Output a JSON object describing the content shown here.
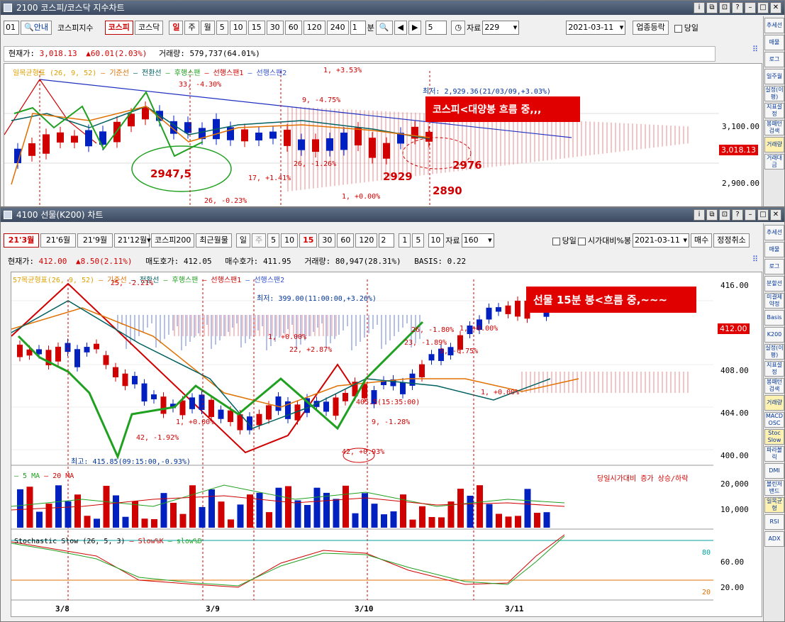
{
  "win1": {
    "title": "2100 코스피/코스닥 지수차트",
    "code": "01",
    "guide": "안내",
    "index_name": "코스피지수",
    "tab_kospi": "코스피",
    "tab_kosdaq": "코스닥",
    "periods": [
      "일",
      "주",
      "월",
      "5",
      "10",
      "15",
      "30",
      "60",
      "120",
      "240"
    ],
    "min_value": "1",
    "min_unit": "분",
    "count": "5",
    "data_label": "자료",
    "data_count": "229",
    "date": "2021-03-11",
    "updown": "업종등락",
    "today": "당일",
    "info": {
      "cur_label": "현재가:",
      "cur": "3,018.13",
      "chg": "▲60.01(2.03%)",
      "vol_label": "거래량:",
      "vol": "579,737(64.01%)"
    },
    "legend": [
      "일목균형표 (26, 9, 52)",
      "기준선",
      "전환선",
      "후행스팬",
      "선행스팬1",
      "선행스팬2"
    ],
    "legend_colors": [
      "#e0a000",
      "#e07000",
      "#006060",
      "#20a020",
      "#d00000",
      "#3050d0"
    ],
    "low_note": "최저: 2,929.36(21/03/09,+3.03%)",
    "annotation": "코스피<대양봉 흐름 중,,,",
    "big_labels": [
      "2947,5",
      "2929",
      "2976",
      "2890"
    ],
    "measure_labels": [
      "33, -4.30%",
      "9, -4.75%",
      "26, -1.26%",
      "17, +1.41%",
      "26, -0.23%",
      "1, +0.00%",
      "1, +3.53%"
    ],
    "axis": [
      "3,100.00",
      "2,900.00"
    ],
    "price_tag": "3,018.13",
    "sidebar": [
      "추세선",
      "매물",
      "로그",
      "일주월",
      "실정(이평)",
      "지표설정",
      "봉패턴검색",
      "거래량",
      "거래대금"
    ]
  },
  "win2": {
    "title": "4100 선물(K200) 차트",
    "contracts": [
      "21'3월",
      "21'6월",
      "21'9월",
      "21'12월"
    ],
    "kospi200": "코스피200",
    "recent_month": "최근월물",
    "periods": [
      "일",
      "주",
      "5",
      "10",
      "15",
      "30",
      "60",
      "120"
    ],
    "min_value": "2",
    "ticks": [
      "1",
      "5"
    ],
    "tick_value": "10",
    "data_label": "자료",
    "data_count": "160",
    "today": "당일",
    "open_vs": "시가대비%봉",
    "date": "2021-03-11",
    "buy": "매수",
    "correct_cancel": "정정취소",
    "info": {
      "cur_label": "현재가:",
      "cur": "412.00",
      "chg": "▲8.50(2.11%)",
      "ask_label": "매도호가:",
      "ask": "412.05",
      "bid_label": "매수호가:",
      "bid": "411.95",
      "vol_label": "거래량:",
      "vol": "80,947(28.31%)",
      "basis_label": "BASIS:",
      "basis": "0.22"
    },
    "legend": [
      "57목균형표(26, 9, 52)",
      "기준선",
      "전환선",
      "후행스팬",
      "선행스팬1",
      "선행스팬2"
    ],
    "legend_colors": [
      "#e0a000",
      "#e07000",
      "#006060",
      "#20a020",
      "#d00000",
      "#3050d0"
    ],
    "low_note": "최저: 399.00(11:00:00,+3.26%)",
    "high_note": "최고: 415.85(09:15:00,-0.93%)",
    "annotation": "선물 15분 봉<흐름 중,~~~",
    "measure_labels": [
      "25, -2.21%",
      "1, +0.00%",
      "22, +2.87%",
      "26, -1.80%",
      "1, +0.00%",
      "23, -1.89%",
      "9, -0.75%",
      "1, +0.00%",
      "1, +0.00%",
      "42, -1.92%",
      "42, +0.93%",
      "9, -1.28%",
      "405.5(15:35:00)"
    ],
    "axis": [
      "416.00",
      "408.00",
      "404.00",
      "400.00"
    ],
    "price_tag": "412.00",
    "vol_legend": [
      "5 MA",
      "20 MA"
    ],
    "vol_note": "당일시가대비 증가 상승/하락",
    "vol_axis": [
      "20,000",
      "10,000"
    ],
    "stoch_title": "Stochastic Slow (26, 5, 3)",
    "stoch_legend": [
      "Slow%K",
      "slow%D"
    ],
    "stoch_levels": [
      "80",
      "20"
    ],
    "stoch_axis": [
      "60.00",
      "20.00"
    ],
    "dates": [
      "3/8",
      "3/9",
      "3/10",
      "3/11"
    ],
    "sidebar": [
      "추세선",
      "매물",
      "로그",
      "분할선",
      "미결제약정",
      "Basis",
      "K200",
      "실정(이평)",
      "지표설정",
      "봉패턴검색",
      "거래량",
      "MACD OSC",
      "Stoc Slow",
      "파라볼릭",
      "DMI",
      "볼린저밴드",
      "일목균형",
      "RSI",
      "ADX"
    ]
  }
}
